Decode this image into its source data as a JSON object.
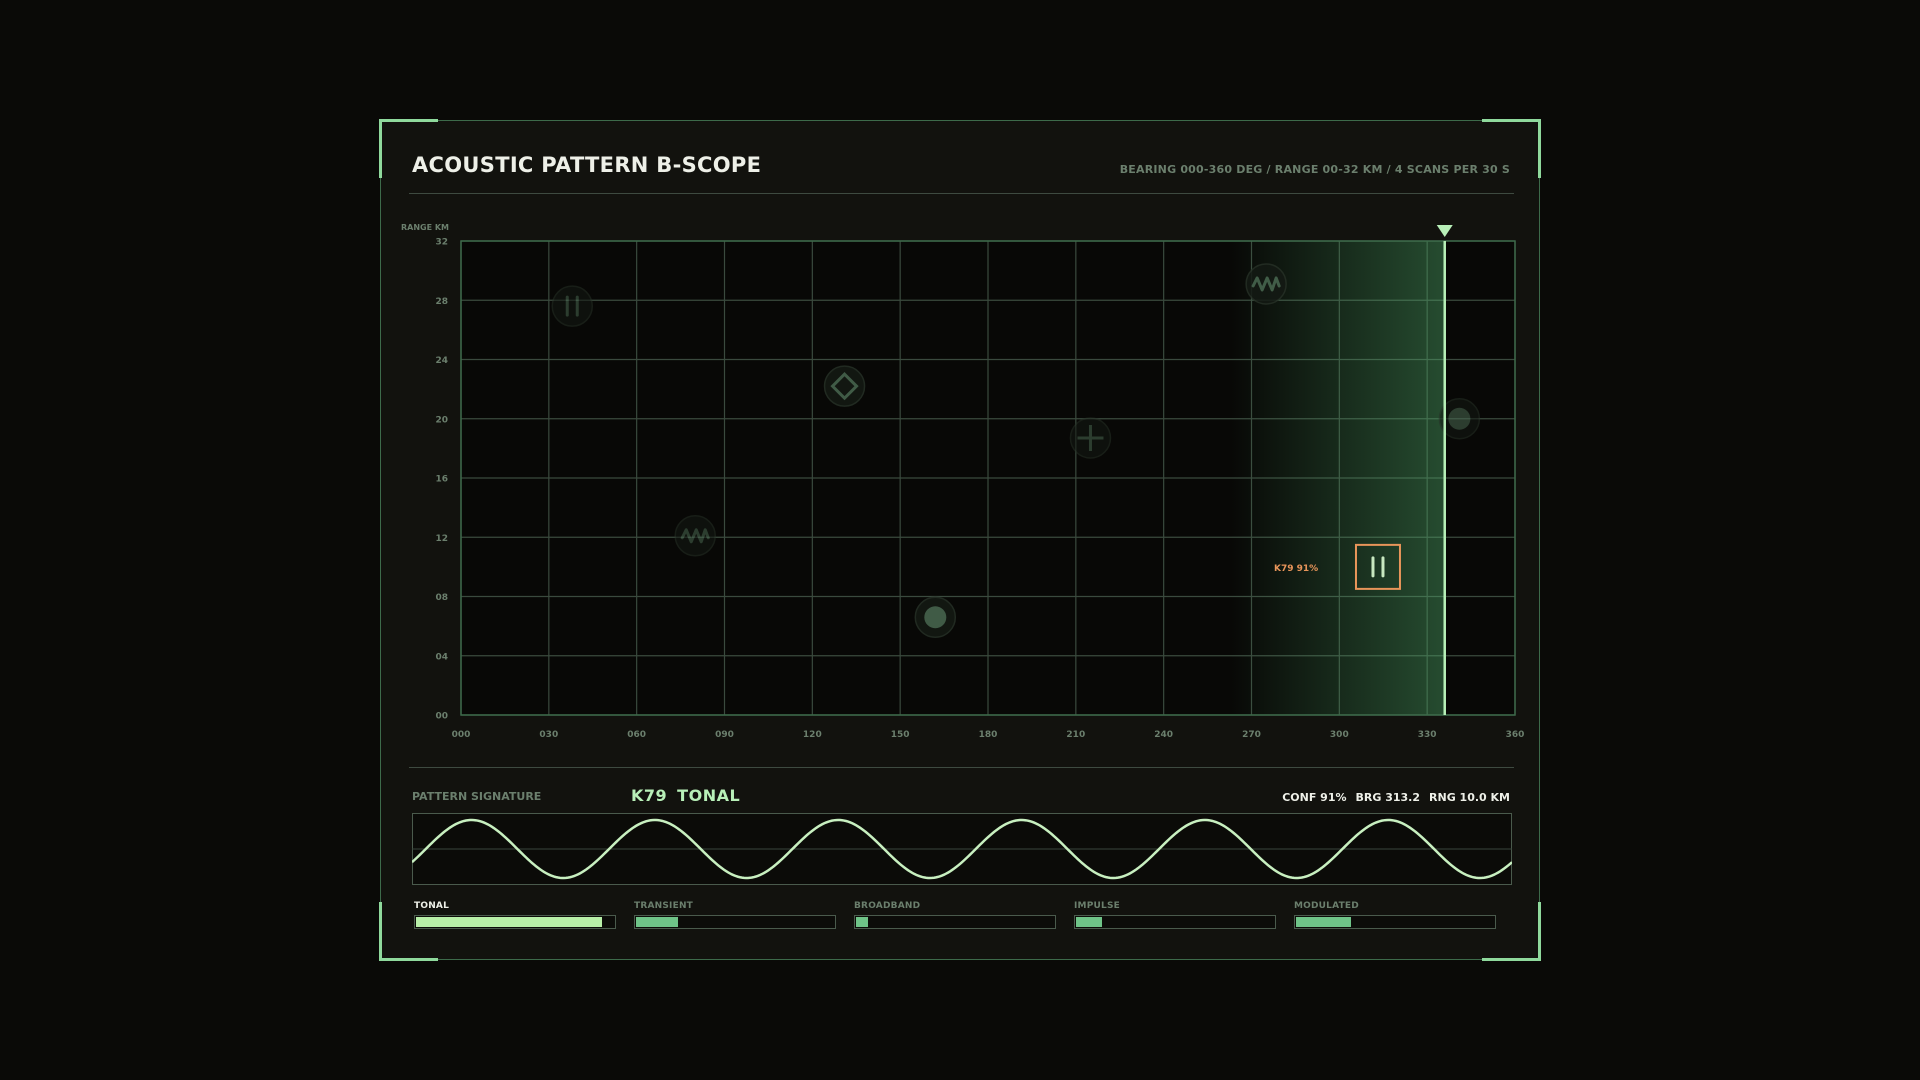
{
  "header": {
    "title": "ACOUSTIC PATTERN B-SCOPE",
    "meta": "BEARING 000-360 DEG / RANGE 00-32 KM / 4 SCANS PER 30 S"
  },
  "scope": {
    "y_axis_label": "RANGE KM",
    "x_ticks": [
      "000",
      "030",
      "060",
      "090",
      "120",
      "150",
      "180",
      "210",
      "240",
      "270",
      "300",
      "330",
      "360"
    ],
    "y_ticks": [
      "00",
      "04",
      "08",
      "12",
      "16",
      "20",
      "24",
      "28",
      "32"
    ],
    "x_range": [
      0,
      360
    ],
    "y_range": [
      0,
      32
    ],
    "sweep_bearing": 336,
    "sweep_trail_start": 263,
    "contacts": [
      {
        "id": "contact-1",
        "symbol": "pause-icon",
        "bearing": 38,
        "range": 27.6,
        "dim": true
      },
      {
        "id": "contact-2",
        "symbol": "wave-icon",
        "bearing": 80,
        "range": 12.1,
        "dim": true
      },
      {
        "id": "contact-3",
        "symbol": "diamond-icon",
        "bearing": 131,
        "range": 22.2,
        "dim": false
      },
      {
        "id": "contact-4",
        "symbol": "dot-icon",
        "bearing": 162,
        "range": 6.6,
        "dim": false
      },
      {
        "id": "contact-5",
        "symbol": "plus-icon",
        "bearing": 215,
        "range": 18.7,
        "dim": true
      },
      {
        "id": "contact-6",
        "symbol": "wave-icon",
        "bearing": 275,
        "range": 29.1,
        "dim": false
      },
      {
        "id": "contact-7",
        "symbol": "dot-icon",
        "bearing": 341,
        "range": 20.0,
        "dim": true
      }
    ],
    "selected": {
      "symbol": "pause-icon",
      "bearing": 313.2,
      "range": 10.0,
      "label": "K79 91%"
    }
  },
  "signature": {
    "section_label": "PATTERN SIGNATURE",
    "id": "K79",
    "type": "TONAL",
    "conf": "CONF 91%",
    "brg": "BRG 313.2",
    "rng": "RNG 10.0 KM",
    "cycles": 6
  },
  "categories": [
    {
      "label": "TONAL",
      "level": 0.94,
      "active": true
    },
    {
      "label": "TRANSIENT",
      "level": 0.21,
      "active": false
    },
    {
      "label": "BROADBAND",
      "level": 0.06,
      "active": false
    },
    {
      "label": "IMPULSE",
      "level": 0.13,
      "active": false
    },
    {
      "label": "MODULATED",
      "level": 0.28,
      "active": false
    }
  ],
  "colors": {
    "accent": "#b8f0b8",
    "grid": "#3a4a3e",
    "selected": "#e8955a",
    "fill": "#6fc488"
  }
}
